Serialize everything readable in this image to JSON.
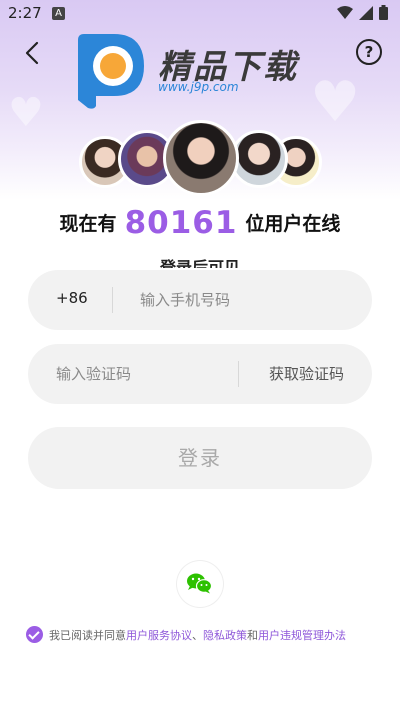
{
  "status_bar": {
    "time": "2:27",
    "notification_letter": "A"
  },
  "header": {
    "logo_title": "精品下载",
    "logo_url": "www.j9p.com",
    "help_label": "?"
  },
  "online": {
    "prefix": "现在有",
    "count": "80161",
    "suffix": "位用户在线"
  },
  "login_hint": "登录后可见",
  "phone": {
    "country_code": "+86",
    "placeholder": "输入手机号码"
  },
  "verification": {
    "placeholder": "输入验证码",
    "get_code_label": "获取验证码"
  },
  "login_button": "登录",
  "agreement": {
    "prefix": "我已阅读并同意",
    "service": "用户服务协议",
    "sep1": "、",
    "privacy": "隐私政策",
    "sep2": "和",
    "violation": "用户违规管理办法",
    "checked": true
  },
  "colors": {
    "accent": "#9b5de5",
    "wechat_green": "#2dc100",
    "logo_blue": "#2c86d8",
    "logo_orange": "#f7a738"
  },
  "icons": [
    "back-arrow-icon",
    "help-icon",
    "wifi-icon",
    "signal-icon",
    "battery-icon",
    "wechat-icon",
    "check-icon"
  ]
}
